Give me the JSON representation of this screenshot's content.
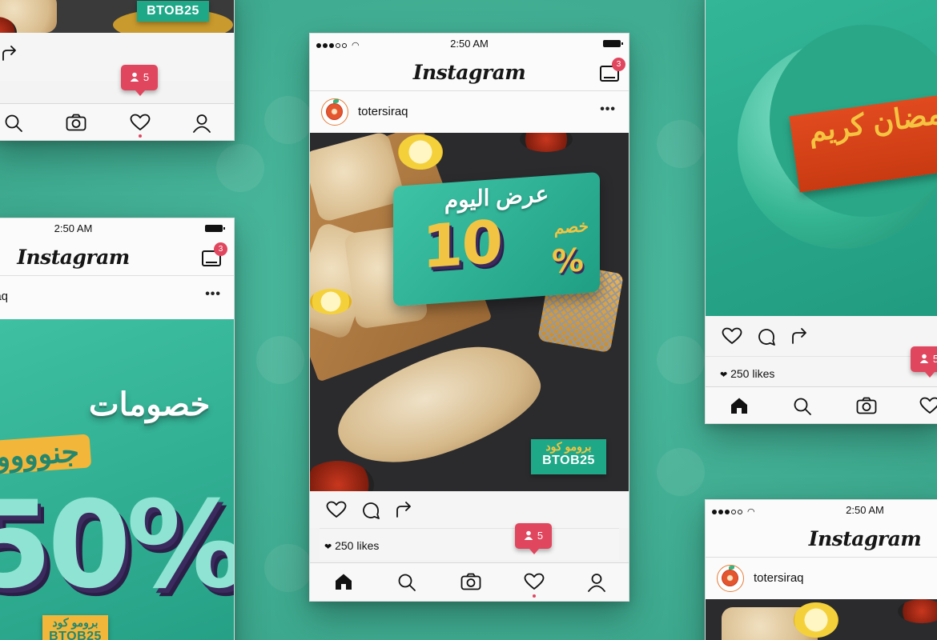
{
  "status": {
    "time": "2:50 AM"
  },
  "app": {
    "name": "Instagram"
  },
  "post": {
    "username": "totersiraq",
    "offer_title": "عرض اليوم",
    "discount_label": "خصم",
    "discount_value": "10",
    "percent_sign": "%",
    "promo_label": "برومو كود",
    "promo_code": "BTOB25",
    "likes": "250 likes"
  },
  "inbox_badge": "3",
  "notification_count": "5",
  "ramadan": {
    "banner_text": "مضان كريم"
  },
  "left_post": {
    "headline": "خصومات",
    "sub": "جنوووو",
    "percent": "50%",
    "promo_label": "برومو كود",
    "promo_code": "BTOB25"
  },
  "colors": {
    "background": "#3fb89a",
    "accent": "#1fa888",
    "badge": "#e0465e",
    "gold": "#f2c443"
  },
  "icons": [
    "home-icon",
    "search-icon",
    "camera-icon",
    "heart-icon",
    "profile-icon",
    "comment-icon",
    "share-icon",
    "inbox-icon"
  ]
}
